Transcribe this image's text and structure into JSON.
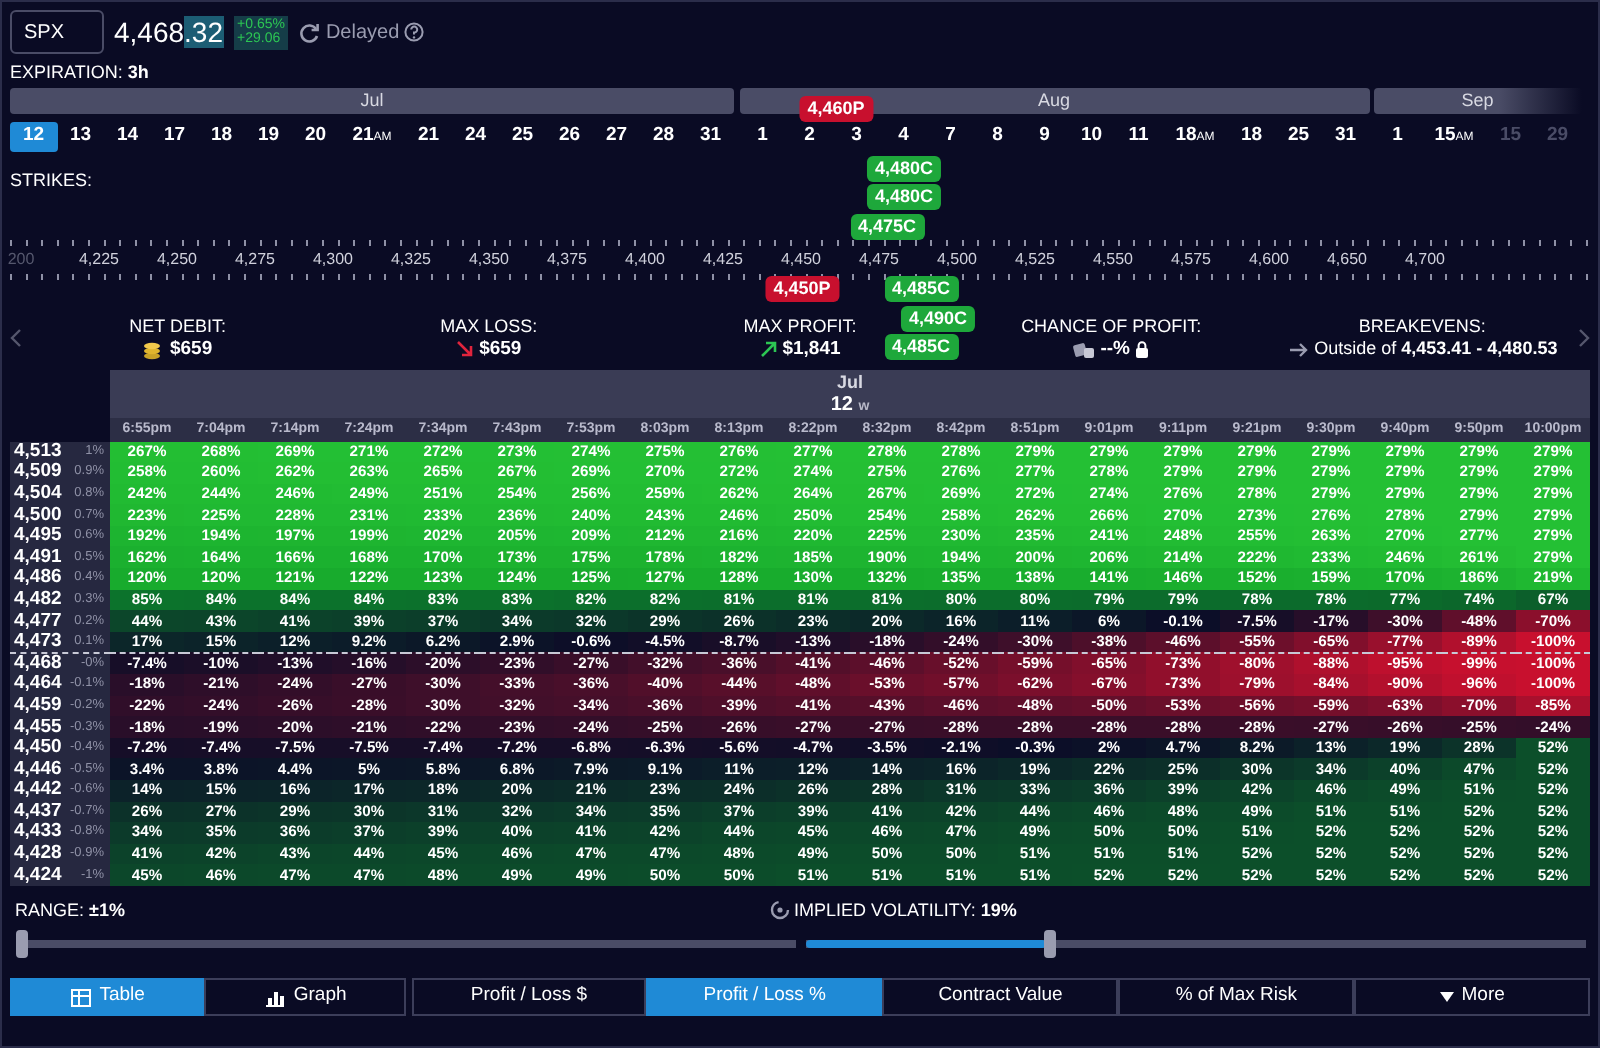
{
  "ticker": {
    "symbol": "SPX",
    "price_whole": "4,468",
    "price_tick": ".32",
    "change_pct": "+0.65%",
    "change_pts": "+29.06",
    "feed": "Delayed"
  },
  "expiration": "EXPIRATION: **3h**",
  "months": [
    {
      "name": "Jul",
      "dimmed": false,
      "dates": [
        {
          "day": "12",
          "selected": true,
          "dimmed": false
        },
        {
          "day": "13",
          "selected": false,
          "dimmed": false
        },
        {
          "day": "14",
          "selected": false,
          "dimmed": false
        },
        {
          "day": "17",
          "selected": false,
          "dimmed": false
        },
        {
          "day": "18",
          "selected": false,
          "dimmed": false
        },
        {
          "day": "19",
          "selected": false,
          "dimmed": false
        },
        {
          "day": "20",
          "selected": false,
          "dimmed": false
        },
        {
          "day": "21",
          "suffix": "AM",
          "selected": false,
          "dimmed": false
        },
        {
          "day": "21",
          "selected": false,
          "dimmed": false
        },
        {
          "day": "24",
          "selected": false,
          "dimmed": false
        },
        {
          "day": "25",
          "selected": false,
          "dimmed": false
        },
        {
          "day": "26",
          "selected": false,
          "dimmed": false
        },
        {
          "day": "27",
          "selected": false,
          "dimmed": false
        },
        {
          "day": "28",
          "selected": false,
          "dimmed": false
        },
        {
          "day": "31",
          "selected": false,
          "dimmed": false
        }
      ]
    },
    {
      "name": "Aug",
      "dimmed": false,
      "dates": [
        {
          "day": "1",
          "selected": false,
          "dimmed": false
        },
        {
          "day": "2",
          "selected": false,
          "dimmed": false
        },
        {
          "day": "3",
          "selected": false,
          "dimmed": false
        },
        {
          "day": "4",
          "selected": false,
          "dimmed": false
        },
        {
          "day": "7",
          "selected": false,
          "dimmed": false
        },
        {
          "day": "8",
          "selected": false,
          "dimmed": false
        },
        {
          "day": "9",
          "selected": false,
          "dimmed": false
        },
        {
          "day": "10",
          "selected": false,
          "dimmed": false
        },
        {
          "day": "11",
          "selected": false,
          "dimmed": false
        },
        {
          "day": "18",
          "suffix": "AM",
          "selected": false,
          "dimmed": false
        },
        {
          "day": "18",
          "selected": false,
          "dimmed": false
        },
        {
          "day": "25",
          "selected": false,
          "dimmed": false
        },
        {
          "day": "31",
          "selected": false,
          "dimmed": false
        }
      ]
    },
    {
      "name": "Sep",
      "dimmed": true,
      "dates": [
        {
          "day": "1",
          "selected": false,
          "dimmed": false
        },
        {
          "day": "15",
          "suffix": "AM",
          "selected": false,
          "dimmed": false
        },
        {
          "day": "15",
          "selected": false,
          "dimmed": true
        },
        {
          "day": "29",
          "selected": false,
          "dimmed": true
        }
      ]
    }
  ],
  "strikes_label": "STRIKES:",
  "strike_axis": [
    "200",
    "4,225",
    "4,250",
    "4,275",
    "4,300",
    "4,325",
    "4,350",
    "4,375",
    "4,400",
    "4,425",
    "4,450",
    "4,475",
    "4,500",
    "4,525",
    "4,550",
    "4,575",
    "4,600",
    "4,650",
    "4,700"
  ],
  "tags_upper": [
    [
      {
        "label": "4,460P",
        "kind": "put"
      }
    ],
    [
      {
        "label": "4,480C",
        "kind": "call"
      }
    ],
    [
      {
        "label": "4,480C",
        "kind": "call"
      }
    ],
    [
      {
        "label": "4,475C",
        "kind": "call"
      }
    ]
  ],
  "tags_lower": [
    [
      {
        "label": "4,450P",
        "kind": "put"
      },
      {
        "label": "4,485C",
        "kind": "call"
      }
    ],
    [
      {
        "label": "4,490C",
        "kind": "call"
      }
    ],
    [
      {
        "label": "4,485C",
        "kind": "call"
      }
    ]
  ],
  "stats": [
    {
      "label": "NET DEBIT:",
      "value": "$659",
      "kind": "debit"
    },
    {
      "label": "MAX LOSS:",
      "value": "$659",
      "kind": "loss"
    },
    {
      "label": "MAX PROFIT:",
      "value": "$1,841",
      "kind": "profit"
    },
    {
      "label": "CHANCE OF PROFIT:",
      "value": "--%",
      "kind": "chance"
    },
    {
      "label": "BREAKEVENS:",
      "value": "Outside of **4,453.41 - 4,480.53**",
      "kind": "breakeven"
    }
  ],
  "table": {
    "month": "Jul",
    "day": "12",
    "weekday": "w",
    "columns": [
      "6:55pm",
      "7:04pm",
      "7:14pm",
      "7:24pm",
      "7:34pm",
      "7:43pm",
      "7:53pm",
      "8:03pm",
      "8:13pm",
      "8:22pm",
      "8:32pm",
      "8:42pm",
      "8:51pm",
      "9:01pm",
      "9:11pm",
      "9:21pm",
      "9:30pm",
      "9:40pm",
      "9:50pm",
      "10:00pm"
    ],
    "rows": [
      {
        "strike": "4,513",
        "move": "1%",
        "price_line": false,
        "cells": [
          "267%",
          "268%",
          "269%",
          "271%",
          "272%",
          "273%",
          "274%",
          "275%",
          "276%",
          "277%",
          "278%",
          "278%",
          "279%",
          "279%",
          "279%",
          "279%",
          "279%",
          "279%",
          "279%",
          "279%"
        ]
      },
      {
        "strike": "4,509",
        "move": "0.9%",
        "price_line": false,
        "cells": [
          "258%",
          "260%",
          "262%",
          "263%",
          "265%",
          "267%",
          "269%",
          "270%",
          "272%",
          "274%",
          "275%",
          "276%",
          "277%",
          "278%",
          "279%",
          "279%",
          "279%",
          "279%",
          "279%",
          "279%"
        ]
      },
      {
        "strike": "4,504",
        "move": "0.8%",
        "price_line": false,
        "cells": [
          "242%",
          "244%",
          "246%",
          "249%",
          "251%",
          "254%",
          "256%",
          "259%",
          "262%",
          "264%",
          "267%",
          "269%",
          "272%",
          "274%",
          "276%",
          "278%",
          "279%",
          "279%",
          "279%",
          "279%"
        ]
      },
      {
        "strike": "4,500",
        "move": "0.7%",
        "price_line": false,
        "cells": [
          "223%",
          "225%",
          "228%",
          "231%",
          "233%",
          "236%",
          "240%",
          "243%",
          "246%",
          "250%",
          "254%",
          "258%",
          "262%",
          "266%",
          "270%",
          "273%",
          "276%",
          "278%",
          "279%",
          "279%"
        ]
      },
      {
        "strike": "4,495",
        "move": "0.6%",
        "price_line": false,
        "cells": [
          "192%",
          "194%",
          "197%",
          "199%",
          "202%",
          "205%",
          "209%",
          "212%",
          "216%",
          "220%",
          "225%",
          "230%",
          "235%",
          "241%",
          "248%",
          "255%",
          "263%",
          "270%",
          "277%",
          "279%"
        ]
      },
      {
        "strike": "4,491",
        "move": "0.5%",
        "price_line": false,
        "cells": [
          "162%",
          "164%",
          "166%",
          "168%",
          "170%",
          "173%",
          "175%",
          "178%",
          "182%",
          "185%",
          "190%",
          "194%",
          "200%",
          "206%",
          "214%",
          "222%",
          "233%",
          "246%",
          "261%",
          "279%"
        ]
      },
      {
        "strike": "4,486",
        "move": "0.4%",
        "price_line": false,
        "cells": [
          "120%",
          "120%",
          "121%",
          "122%",
          "123%",
          "124%",
          "125%",
          "127%",
          "128%",
          "130%",
          "132%",
          "135%",
          "138%",
          "141%",
          "146%",
          "152%",
          "159%",
          "170%",
          "186%",
          "219%"
        ]
      },
      {
        "strike": "4,482",
        "move": "0.3%",
        "price_line": false,
        "cells": [
          "85%",
          "84%",
          "84%",
          "84%",
          "83%",
          "83%",
          "82%",
          "82%",
          "81%",
          "81%",
          "81%",
          "80%",
          "80%",
          "79%",
          "79%",
          "78%",
          "78%",
          "77%",
          "74%",
          "67%"
        ]
      },
      {
        "strike": "4,477",
        "move": "0.2%",
        "price_line": false,
        "cells": [
          "44%",
          "43%",
          "41%",
          "39%",
          "37%",
          "34%",
          "32%",
          "29%",
          "26%",
          "23%",
          "20%",
          "16%",
          "11%",
          "6%",
          "-0.1%",
          "-7.5%",
          "-17%",
          "-30%",
          "-48%",
          "-70%"
        ]
      },
      {
        "strike": "4,473",
        "move": "0.1%",
        "price_line": false,
        "cells": [
          "17%",
          "15%",
          "12%",
          "9.2%",
          "6.2%",
          "2.9%",
          "-0.6%",
          "-4.5%",
          "-8.7%",
          "-13%",
          "-18%",
          "-24%",
          "-30%",
          "-38%",
          "-46%",
          "-55%",
          "-65%",
          "-77%",
          "-89%",
          "-100%"
        ]
      },
      {
        "strike": "4,468",
        "move": "-0%",
        "price_line": true,
        "cells": [
          "-7.4%",
          "-10%",
          "-13%",
          "-16%",
          "-20%",
          "-23%",
          "-27%",
          "-32%",
          "-36%",
          "-41%",
          "-46%",
          "-52%",
          "-59%",
          "-65%",
          "-73%",
          "-80%",
          "-88%",
          "-95%",
          "-99%",
          "-100%"
        ]
      },
      {
        "strike": "4,464",
        "move": "-0.1%",
        "price_line": false,
        "cells": [
          "-18%",
          "-21%",
          "-24%",
          "-27%",
          "-30%",
          "-33%",
          "-36%",
          "-40%",
          "-44%",
          "-48%",
          "-53%",
          "-57%",
          "-62%",
          "-67%",
          "-73%",
          "-79%",
          "-84%",
          "-90%",
          "-96%",
          "-100%"
        ]
      },
      {
        "strike": "4,459",
        "move": "-0.2%",
        "price_line": false,
        "cells": [
          "-22%",
          "-24%",
          "-26%",
          "-28%",
          "-30%",
          "-32%",
          "-34%",
          "-36%",
          "-39%",
          "-41%",
          "-43%",
          "-46%",
          "-48%",
          "-50%",
          "-53%",
          "-56%",
          "-59%",
          "-63%",
          "-70%",
          "-85%"
        ]
      },
      {
        "strike": "4,455",
        "move": "-0.3%",
        "price_line": false,
        "cells": [
          "-18%",
          "-19%",
          "-20%",
          "-21%",
          "-22%",
          "-23%",
          "-24%",
          "-25%",
          "-26%",
          "-27%",
          "-27%",
          "-28%",
          "-28%",
          "-28%",
          "-28%",
          "-28%",
          "-27%",
          "-26%",
          "-25%",
          "-24%"
        ]
      },
      {
        "strike": "4,450",
        "move": "-0.4%",
        "price_line": false,
        "cells": [
          "-7.2%",
          "-7.4%",
          "-7.5%",
          "-7.5%",
          "-7.4%",
          "-7.2%",
          "-6.8%",
          "-6.3%",
          "-5.6%",
          "-4.7%",
          "-3.5%",
          "-2.1%",
          "-0.3%",
          "2%",
          "4.7%",
          "8.2%",
          "13%",
          "19%",
          "28%",
          "52%"
        ]
      },
      {
        "strike": "4,446",
        "move": "-0.5%",
        "price_line": false,
        "cells": [
          "3.4%",
          "3.8%",
          "4.4%",
          "5%",
          "5.8%",
          "6.8%",
          "7.9%",
          "9.1%",
          "11%",
          "12%",
          "14%",
          "16%",
          "19%",
          "22%",
          "25%",
          "30%",
          "34%",
          "40%",
          "47%",
          "52%"
        ]
      },
      {
        "strike": "4,442",
        "move": "-0.6%",
        "price_line": false,
        "cells": [
          "14%",
          "15%",
          "16%",
          "17%",
          "18%",
          "20%",
          "21%",
          "23%",
          "24%",
          "26%",
          "28%",
          "31%",
          "33%",
          "36%",
          "39%",
          "42%",
          "46%",
          "49%",
          "51%",
          "52%"
        ]
      },
      {
        "strike": "4,437",
        "move": "-0.7%",
        "price_line": false,
        "cells": [
          "26%",
          "27%",
          "29%",
          "30%",
          "31%",
          "32%",
          "34%",
          "35%",
          "37%",
          "39%",
          "41%",
          "42%",
          "44%",
          "46%",
          "48%",
          "49%",
          "51%",
          "51%",
          "52%",
          "52%"
        ]
      },
      {
        "strike": "4,433",
        "move": "-0.8%",
        "price_line": false,
        "cells": [
          "34%",
          "35%",
          "36%",
          "37%",
          "39%",
          "40%",
          "41%",
          "42%",
          "44%",
          "45%",
          "46%",
          "47%",
          "49%",
          "50%",
          "50%",
          "51%",
          "52%",
          "52%",
          "52%",
          "52%"
        ]
      },
      {
        "strike": "4,428",
        "move": "-0.9%",
        "price_line": false,
        "cells": [
          "41%",
          "42%",
          "43%",
          "44%",
          "45%",
          "46%",
          "47%",
          "47%",
          "48%",
          "49%",
          "50%",
          "50%",
          "51%",
          "51%",
          "51%",
          "52%",
          "52%",
          "52%",
          "52%",
          "52%"
        ]
      },
      {
        "strike": "4,424",
        "move": "-1%",
        "price_line": false,
        "cells": [
          "45%",
          "46%",
          "47%",
          "47%",
          "48%",
          "49%",
          "49%",
          "50%",
          "50%",
          "51%",
          "51%",
          "51%",
          "51%",
          "52%",
          "52%",
          "52%",
          "52%",
          "52%",
          "52%",
          "52%"
        ]
      }
    ]
  },
  "range": {
    "label": "RANGE: **±1%**",
    "level": 0
  },
  "volatility": {
    "label": "IMPLIED VOLATILITY: **19%**",
    "level": 0.31
  },
  "view_tabs": [
    {
      "label": "Table",
      "kind": "table",
      "selected": true
    },
    {
      "label": "Graph",
      "kind": "graph",
      "selected": false
    }
  ],
  "metric_tabs": [
    {
      "label": "Profit / Loss $",
      "kind": "plain",
      "selected": false
    },
    {
      "label": "Profit / Loss %",
      "kind": "plain",
      "selected": true
    },
    {
      "label": "Contract Value",
      "kind": "plain",
      "selected": false
    },
    {
      "label": "% of Max Risk",
      "kind": "plain",
      "selected": false
    },
    {
      "label": "More",
      "kind": "menu",
      "selected": false
    }
  ]
}
